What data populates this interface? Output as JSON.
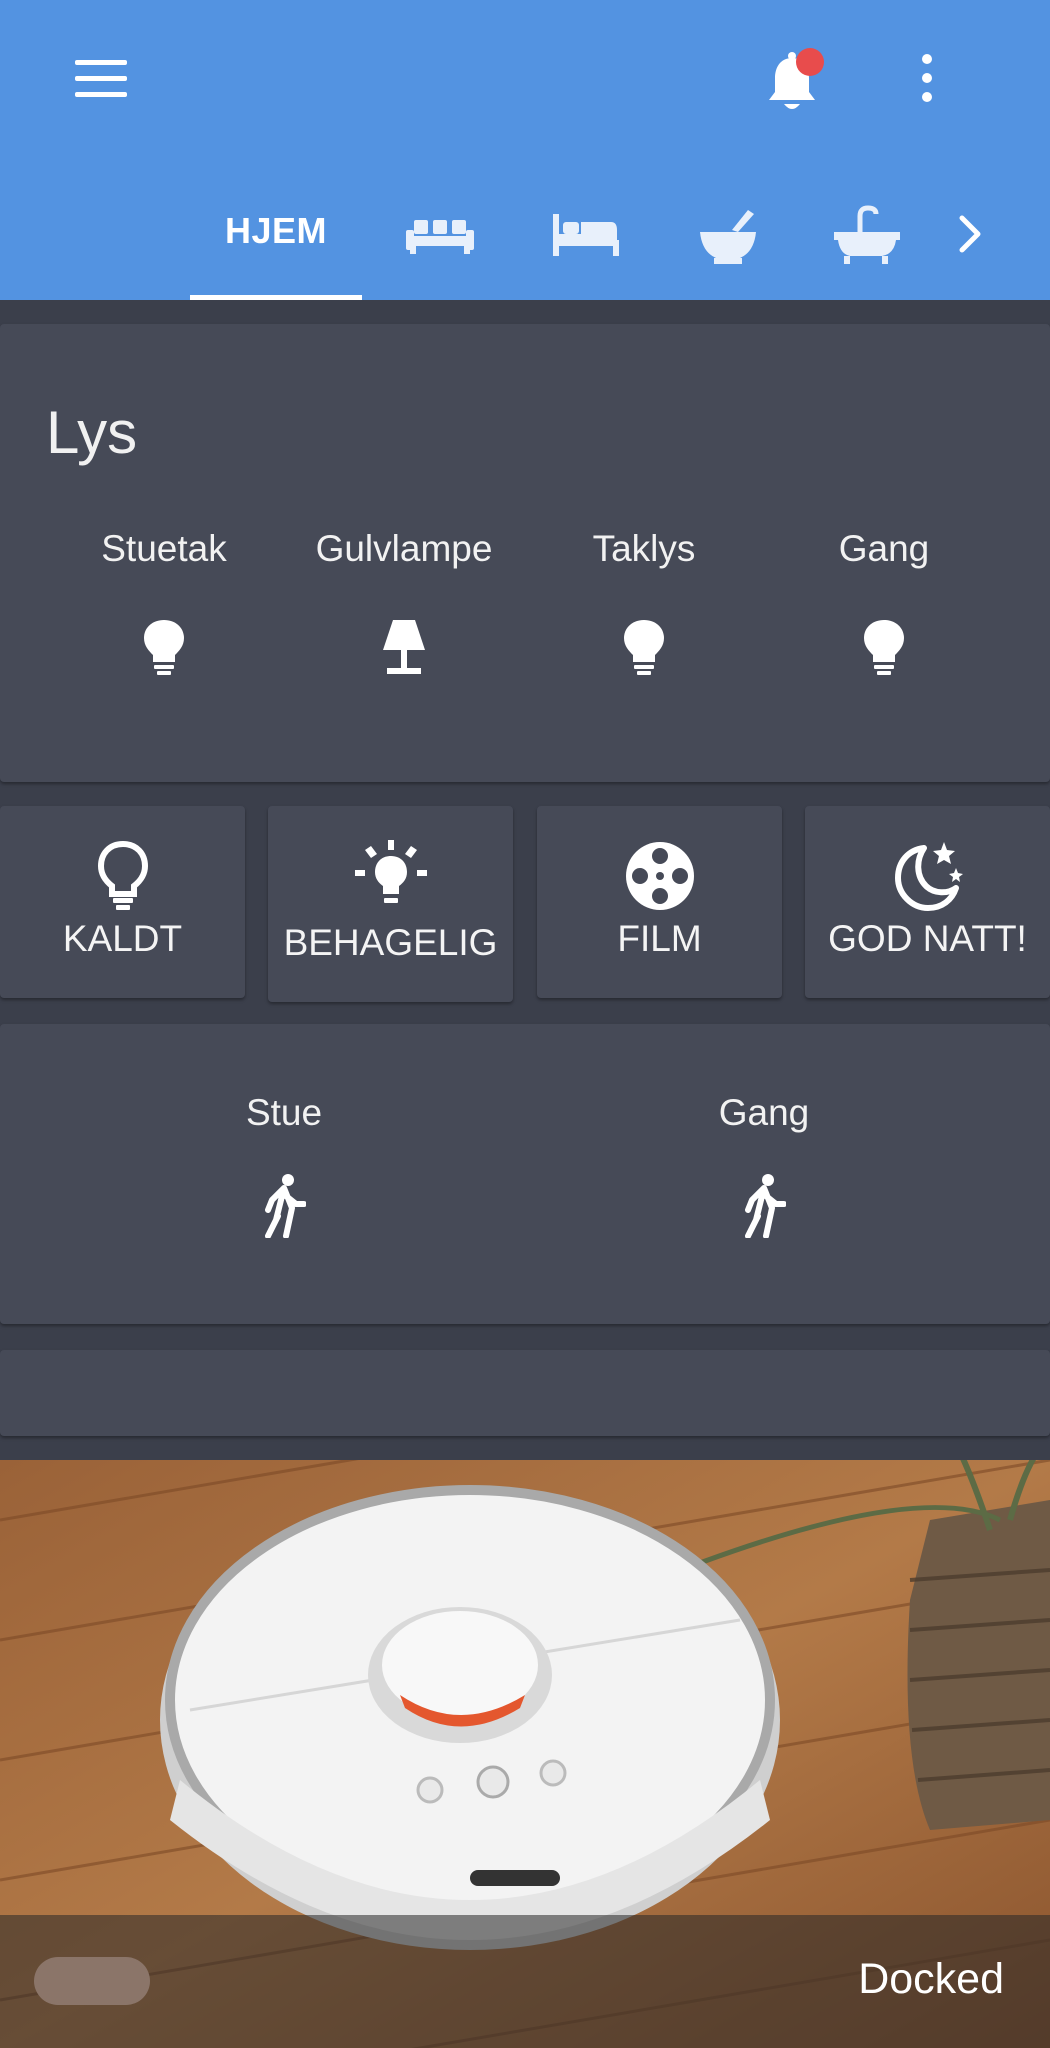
{
  "header": {
    "tabs": [
      {
        "label": "HJEM",
        "active": true
      },
      {
        "icon": "sofa-icon"
      },
      {
        "icon": "bed-icon"
      },
      {
        "icon": "mortar-icon"
      },
      {
        "icon": "bathtub-icon"
      }
    ],
    "accent_color": "#5393e1",
    "notification_dot_color": "#e84c4c"
  },
  "lights_card": {
    "title": "Lys",
    "items": [
      {
        "name": "Stuetak",
        "icon": "lightbulb-icon"
      },
      {
        "name": "Gulvlampe",
        "icon": "floor-lamp-icon"
      },
      {
        "name": "Taklys",
        "icon": "lightbulb-icon"
      },
      {
        "name": "Gang",
        "icon": "lightbulb-icon"
      }
    ]
  },
  "scenes": [
    {
      "name": "KALDT",
      "icon": "lightbulb-outline-icon"
    },
    {
      "name": "BEHAGELIG",
      "icon": "lightbulb-on-icon"
    },
    {
      "name": "FILM",
      "icon": "film-reel-icon"
    },
    {
      "name": "GOD NATT!",
      "icon": "moon-stars-icon"
    }
  ],
  "motion_card": {
    "items": [
      {
        "name": "Stue",
        "icon": "walking-person-icon"
      },
      {
        "name": "Gang",
        "icon": "walking-person-icon"
      }
    ]
  },
  "camera": {
    "state": "Docked"
  }
}
